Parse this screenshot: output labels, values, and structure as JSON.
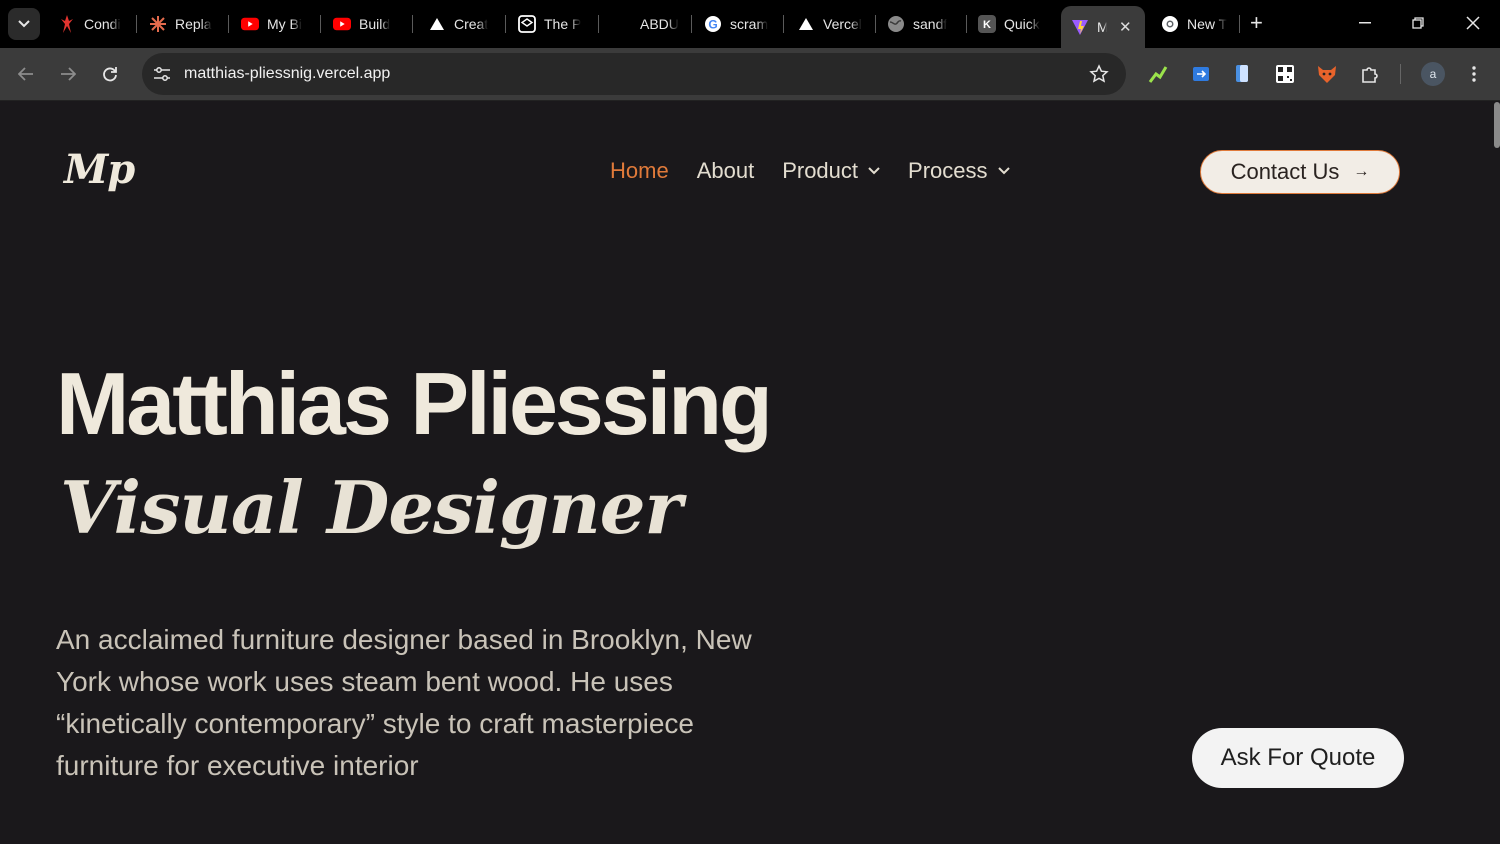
{
  "browser": {
    "tabs": [
      {
        "label": "Condi",
        "icon": "red-figure-icon"
      },
      {
        "label": "Repla",
        "icon": "asterisk-icon"
      },
      {
        "label": "My Bi",
        "icon": "youtube-icon"
      },
      {
        "label": "Build",
        "icon": "youtube-icon"
      },
      {
        "label": "Creat",
        "icon": "triangle-icon"
      },
      {
        "label": "The P",
        "icon": "codepen-icon"
      },
      {
        "label": "ABDU",
        "icon": "none"
      },
      {
        "label": "scram",
        "icon": "google-icon"
      },
      {
        "label": "Vercel",
        "icon": "triangle-icon"
      },
      {
        "label": "sandf",
        "icon": "globe-icon"
      },
      {
        "label": "Quick",
        "icon": "k-icon"
      },
      {
        "label": "M",
        "icon": "vite-icon",
        "active": true
      },
      {
        "label": "New T",
        "icon": "chrome-icon"
      }
    ],
    "url": "matthias-pliessnig.vercel.app",
    "profile_initial": "a"
  },
  "site": {
    "logo": "Mp",
    "nav": {
      "home": "Home",
      "about": "About",
      "product": "Product",
      "process": "Process"
    },
    "contact_label": "Contact Us",
    "contact_arrow": "→",
    "hero_name": "Matthias Pliessing",
    "hero_role": "Visual Designer",
    "hero_desc": "An acclaimed furniture designer based in Brooklyn, New York whose work uses steam bent wood. He uses “kinetically contemporary” style to craft masterpiece furniture for executive interior",
    "quote_label": "Ask For Quote"
  },
  "colors": {
    "page_bg": "#1a181b",
    "accent": "#e07a3a",
    "cream": "#efe9dc"
  }
}
